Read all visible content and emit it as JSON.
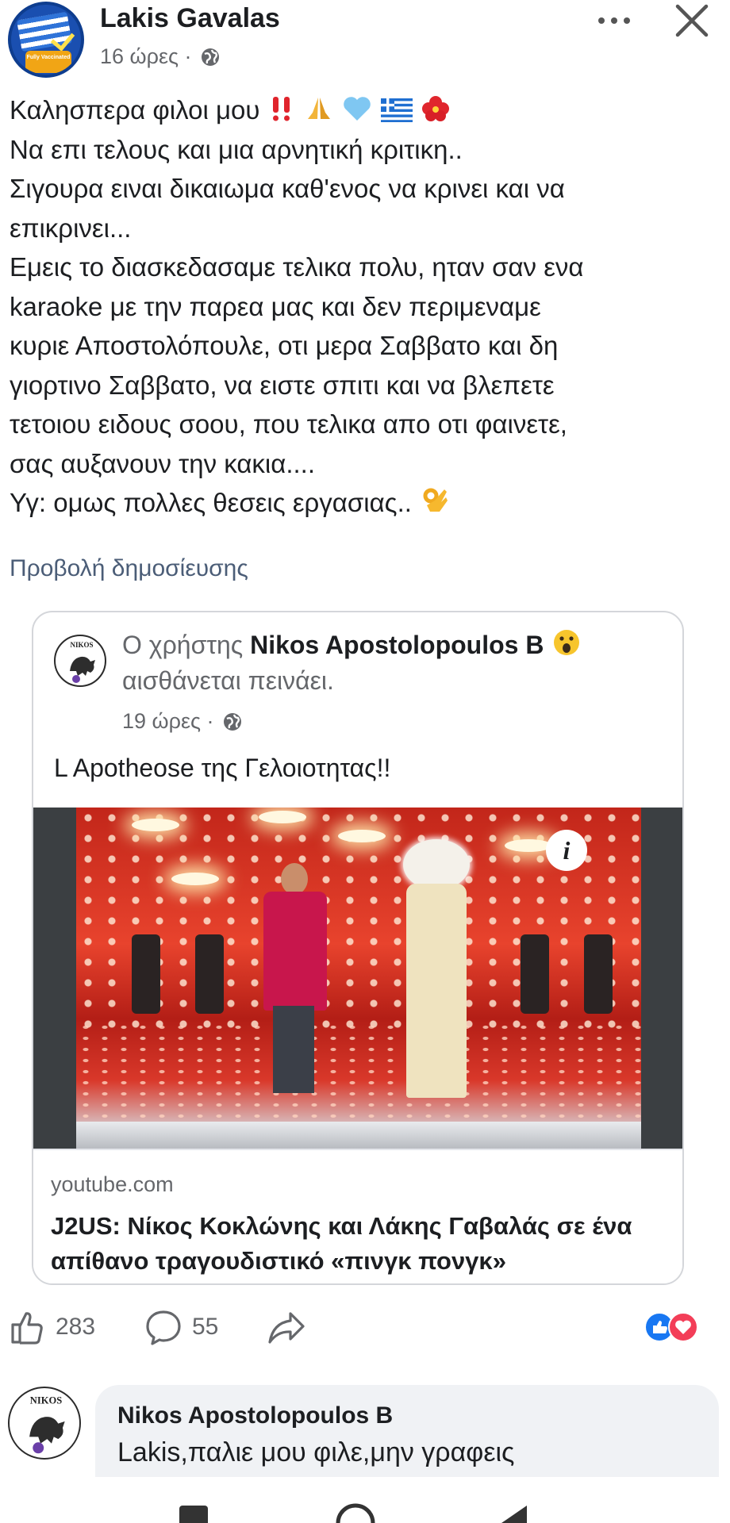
{
  "post": {
    "author": "Lakis Gavalas",
    "time": "16 ώρες · ",
    "avatar_badge": "Fully Vaccinated",
    "lines": [
      "Καλησπερα φιλοι μου",
      "Να επι τελους και μια αρνητική κριτικη..",
      "Σιγουρα ειναι δικαιωμα καθ'ενος να κρινει και να",
      "επικρινει...",
      "Εμεις το διασκεδασαμε τελικα πολυ, ηταν σαν ενα",
      "karaoke με την παρεα μας και δεν περιμεναμε",
      "κυριε Αποστολόπουλε, οτι μερα Σαββατο και δη",
      "γιορτινο Σαββατο, να ειστε σπιτι και να βλεπετε",
      "τετοιου ειδους σοου, που τελικα απο οτι φαινετε,",
      "σας αυξανουν την κακια....",
      "Υγ: ομως πολλες θεσεις εργασιας.."
    ],
    "view_post": "Προβολή δημοσίευσης"
  },
  "shared": {
    "prefix": "Ο χρήστης ",
    "author": "Nikos Apostolopoulos B",
    "feeling": "αισθάνεται πεινάει.",
    "time": "19 ώρες · ",
    "text": "L Apotheose της Γελοιοτητας!!",
    "logo_text": "NIKOS",
    "info_label": "i",
    "link_domain": "youtube.com",
    "link_title": "J2US: Νίκος Κοκλώνης και Λάκης Γαβαλάς σε ένα απίθανο τραγουδιστικό «πινγκ πονγκ»"
  },
  "actions": {
    "likes": "283",
    "comments": "55"
  },
  "comment": {
    "author": "Nikos Apostolopoulos B",
    "text": "Lakis,παλιε μου φιλε,μην γραφεις"
  },
  "colors": {
    "secondary_text": "#65676b",
    "link_blue": "#4b5d77",
    "like_blue": "#1877f2",
    "love_red": "#f33e58"
  },
  "icons": [
    "more-icon",
    "close-icon",
    "globe-icon",
    "like-icon",
    "comment-icon",
    "share-icon",
    "info-icon"
  ]
}
